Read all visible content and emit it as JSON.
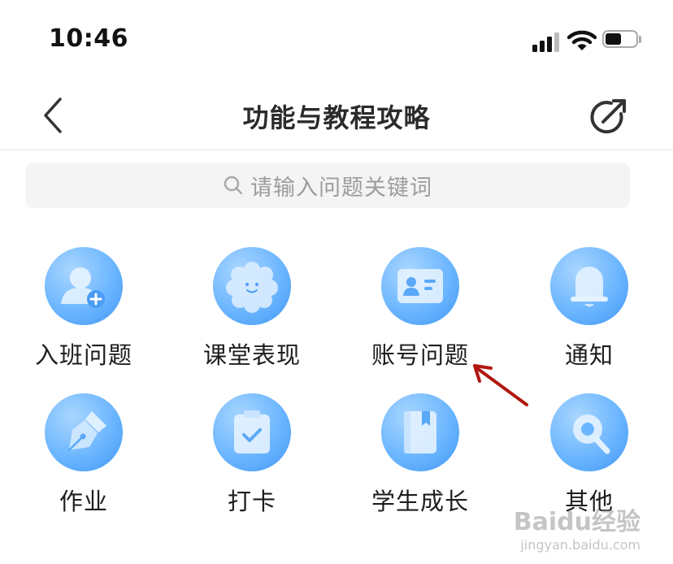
{
  "status_bar": {
    "time": "10:46"
  },
  "nav": {
    "title": "功能与教程攻略"
  },
  "search": {
    "placeholder": "请输入问题关键词"
  },
  "grid": {
    "items": [
      {
        "label": "入班问题",
        "icon": "add-user-icon"
      },
      {
        "label": "课堂表现",
        "icon": "smiley-flower-icon"
      },
      {
        "label": "账号问题",
        "icon": "id-card-icon"
      },
      {
        "label": "通知",
        "icon": "bell-icon"
      },
      {
        "label": "作业",
        "icon": "fountain-pen-icon"
      },
      {
        "label": "打卡",
        "icon": "clipboard-check-icon"
      },
      {
        "label": "学生成长",
        "icon": "book-icon"
      },
      {
        "label": "其他",
        "icon": "search-magnifier-icon"
      }
    ]
  },
  "colors": {
    "icon_blue": "#4fa4fb",
    "arrow_red": "#b0170f"
  },
  "watermark": {
    "main": "Baidu经验",
    "sub": "jingyan.baidu.com"
  }
}
